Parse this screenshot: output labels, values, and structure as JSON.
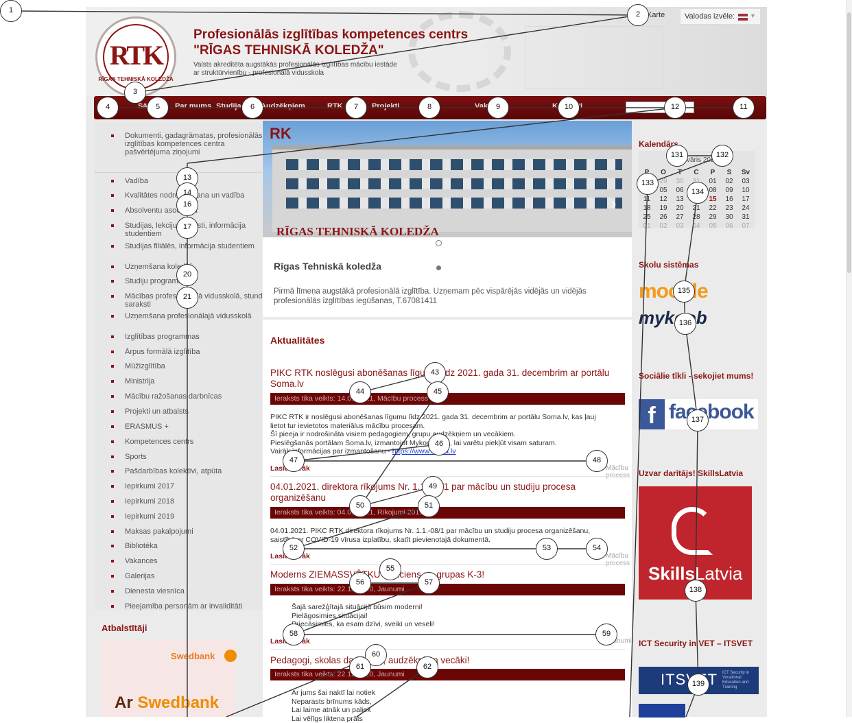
{
  "header": {
    "title_line1": "Profesionālās izglītības kompetences centrs",
    "title_line2": "\"RĪGAS TEHNISKĀ KOLEDŽA\"",
    "subtitle_line1": "Valsts akreditēta augstākās profesionālās izglītības mācību iestāde",
    "subtitle_line2": "ar struktūrvienību - profesionālā vidusskola",
    "logo_text": "RTK",
    "logo_ring_text": "RĪGAS TEHNISKĀ KOLEDŽA",
    "top_link": "Karte",
    "language_label": "Valodas izvēle:"
  },
  "nav": {
    "items": [
      "Sākums",
      "Par mums",
      "Studijas",
      "Audzēkņiem",
      "RTK",
      "Projekti",
      "Vakances",
      "Kontakti"
    ]
  },
  "left_menu": {
    "items": [
      "Dokumenti, gadagrāmatas, profesionālās izglītības kompetences centra pašvērtējuma ziņojumi",
      "Vadība",
      "Kvalitātes nodrošināšana un vadība",
      "Absolventu asociācija",
      "Studijas, lekciju saraksti, informācija studentiem",
      "Studijas filiālēs, informācija studentiem",
      "Uzņemšana koledžā",
      "Studiju programmas",
      "Mācības profesionālajā vidusskolā, stundu saraksti",
      "Uzņemšana profesionālajā vidusskolā",
      "Izglītības programmas",
      "Ārpus formālā izglītība",
      "Mūžizglītība",
      "Ministrija",
      "Mācību ražošanas darbnīcas",
      "Projekti un atbalsts",
      "ERASMUS +",
      "Kompetences centrs",
      "Sports",
      "Pašdarbības kolektīvi, atpūta",
      "Iepirkumi 2017",
      "Iepirkumi 2018",
      "Iepirkumi 2019",
      "Maksas pakalpojumi",
      "Bibliotēka",
      "Vakances",
      "Galerijas",
      "Dienesta viesnīca",
      "Pieejamība personām ar invaliditāti"
    ],
    "supporters_heading": "Atbalstītāji",
    "swedbank_logo": "Swedbank",
    "swedbank_ad_1": "Ar ",
    "swedbank_ad_2": "Swedbank"
  },
  "slider": {
    "building_sign": "RĪGAS TEHNISKĀ KOLEDŽA",
    "corner_logo": "RK",
    "next_arrow": "›",
    "caption_title": "Rīgas Tehniskā koledža",
    "caption_text": "Pirmā līmeņa augstākā profesionālā izglītība. Uzņemam pēc vispārējās vidējās un vidējās profesionālās izglītības iegūšanas, T.67081411"
  },
  "news": {
    "heading": "Aktualitātes",
    "posts": [
      {
        "title": "PIKC RTK noslēgusi abonēšanas līgumu līdz 2021. gada 31. decembrim ar portālu Soma.lv",
        "meta": "Ieraksts tika veikts: 14.01.2021, Mācību process",
        "text": [
          "PIKC RTK ir noslēgusi abonēšanas līgumu līdz 2021. gada 31. decembrim ar portālu Soma.lv, kas ļauj",
          "lietot tur ievietotos materiālus mācību procesam.",
          "Šī pieeja ir nodrošināta visiem pedagogiem, grupu audzēkņiem un vecākiem.",
          "Pieslēgšanās portālam Soma.lv, izmantojot Mykoob pasi, lai varētu piekļūt visam saturam."
        ],
        "link_prefix": "Vairāk informācijas par izmantošanu - ",
        "link_text": "https://www.soma.lv",
        "read_more": "Lasīt vairāk",
        "category": "Mācību process"
      },
      {
        "title": "04.01.2021. direktora rīkojums Nr. 1.1.-08/1 par mācību un studiju procesa organizēšanu",
        "meta": "Ieraksts tika veikts: 04.01.2021, Rīkojumi 2019",
        "text": [
          "04.01.2021. PIKC RTK direktora rīkojums Nr. 1.1.-08/1 par mācību un studiju procesa organizēšanu,",
          "saistībā ar COVID-19 vīrusa izplatību, skatīt pievienotajā dokumentā."
        ],
        "read_more": "Lasīt vairāk",
        "category": "Mācību process"
      },
      {
        "title": "Moderns ZIEMASSVĒTKU sveiciens no grupas K-3!",
        "meta": "Ieraksts tika veikts: 22.12.2020, Jaunumi",
        "text": [
          "Šajā sarežģītajā situācijā būsim moderni!",
          "Pielāgosimies situācijai!",
          "Priecāsimies, ka esam dzīvi, sveiki un veseli!"
        ],
        "read_more": "Lasīt vairāk",
        "category": "Jaunumi"
      },
      {
        "title": "Pedagogi, skolas darbinieki, audzēkņi un vecāki!",
        "meta": "Ieraksts tika veikts: 22.12.2020, Jaunumi",
        "text": [
          "Ar jums šai naktī lai notiek",
          "Neparasts brīnums kāds,",
          "Lai laime atnāk un paliek",
          "Lai vēlīgs liktena prāts"
        ]
      }
    ]
  },
  "right": {
    "calendar_heading": "Kalendārs",
    "calendar_month": "Janvāris 2021",
    "calendar_days": [
      "P",
      "O",
      "T",
      "C",
      "P",
      "S",
      "Sv"
    ],
    "calendar_weeks": [
      [
        "28",
        "29",
        "30",
        "31",
        "01",
        "02",
        "03"
      ],
      [
        "04",
        "05",
        "06",
        "07",
        "08",
        "09",
        "10"
      ],
      [
        "11",
        "12",
        "13",
        "14",
        "15",
        "16",
        "17"
      ],
      [
        "18",
        "19",
        "20",
        "21",
        "22",
        "23",
        "24"
      ],
      [
        "25",
        "26",
        "27",
        "28",
        "29",
        "30",
        "31"
      ],
      [
        "01",
        "02",
        "03",
        "04",
        "05",
        "06",
        "07"
      ]
    ],
    "systems_heading": "Skolu sistēmas",
    "moodle": "moodle",
    "mykoob": "mykoob",
    "social_heading": "Sociālie tīkli - sekojiet mums!",
    "facebook": "facebook",
    "skills_heading": "Uzvar darītājs! SkillsLatvia",
    "skills_1": "Skills",
    "skills_2": "Latvia",
    "itsvet_heading": "ICT Security in VET – ITSVET",
    "itsvet": "ITSVET",
    "itsvet_sub": "ICT Security in Vocational Education and Training"
  },
  "annotations": [
    "1",
    "2",
    "3",
    "4",
    "5",
    "6",
    "7",
    "8",
    "9",
    "10",
    "11",
    "12",
    "13",
    "14",
    "16",
    "17",
    "20",
    "21",
    "43",
    "44",
    "45",
    "46",
    "47",
    "48",
    "49",
    "50",
    "51",
    "52",
    "53",
    "54",
    "55",
    "56",
    "57",
    "58",
    "59",
    "60",
    "61",
    "62",
    "131",
    "132",
    "133",
    "134",
    "135",
    "136",
    "137",
    "138",
    "139"
  ],
  "colors": {
    "brand": "#8b1515",
    "nav": "#6b0606",
    "facebook": "#3b5998",
    "skills": "#c0252d"
  }
}
